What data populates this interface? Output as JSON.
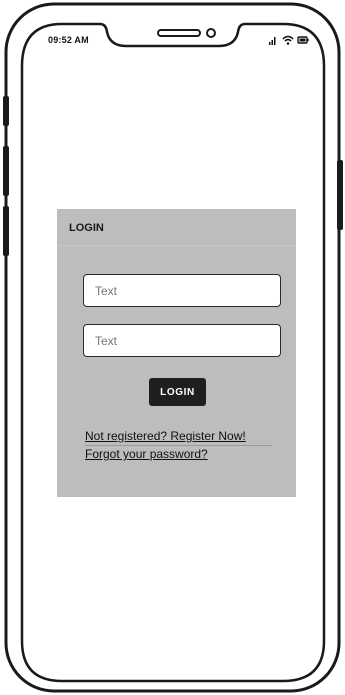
{
  "status_bar": {
    "time": "09:52 AM",
    "icons": [
      "signal-icon",
      "wifi-icon",
      "battery-icon"
    ]
  },
  "login_panel": {
    "title": "LOGIN",
    "username_placeholder": "Text",
    "password_placeholder": "Text",
    "login_button_label": "LOGIN",
    "register_link": "Not registered? Register Now!",
    "forgot_link": "Forgot your password?"
  },
  "colors": {
    "panel_background": "#bdbdbd",
    "button_background": "#1f1f1f",
    "button_text": "#ffffff",
    "device_outline": "#1a1a1a"
  }
}
